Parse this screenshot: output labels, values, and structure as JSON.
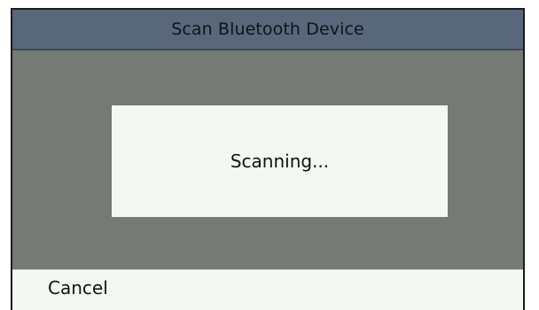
{
  "header": {
    "title": "Scan Bluetooth Device"
  },
  "dialog": {
    "message": "Scanning..."
  },
  "softkeys": {
    "cancel_label": "Cancel"
  },
  "colors": {
    "title_bar": "#58677a",
    "overlay": "#767a75",
    "dialog_background": "#f4f8f3",
    "softkey_bar": "#f4f8f3"
  }
}
